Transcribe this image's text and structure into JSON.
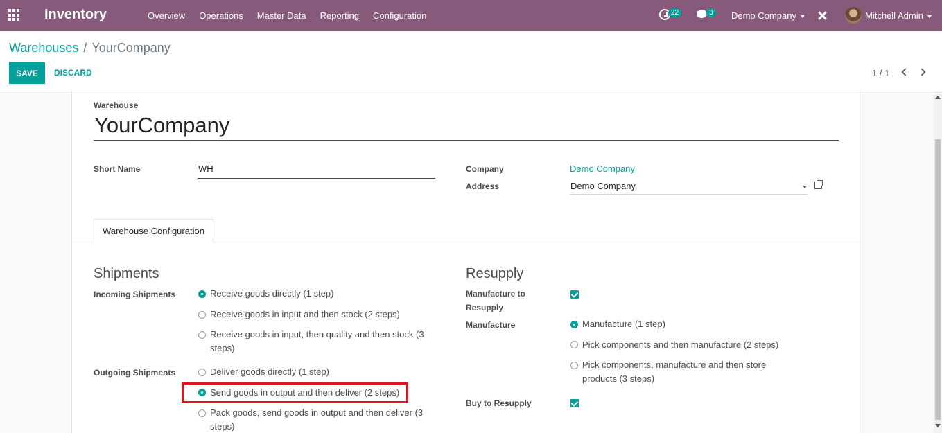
{
  "navbar": {
    "app_name": "Inventory",
    "menu": [
      "Overview",
      "Operations",
      "Master Data",
      "Reporting",
      "Configuration"
    ],
    "activity_count": "22",
    "message_count": "3",
    "company": "Demo Company",
    "user": "Mitchell Admin"
  },
  "breadcrumb": {
    "parent": "Warehouses",
    "separator": "/",
    "current": "YourCompany"
  },
  "buttons": {
    "save": "SAVE",
    "discard": "DISCARD"
  },
  "pager": "1 / 1",
  "form": {
    "warehouse_label": "Warehouse",
    "warehouse_name": "YourCompany",
    "short_name_label": "Short Name",
    "short_name": "WH",
    "company_label": "Company",
    "company_value": "Demo Company",
    "address_label": "Address",
    "address_value": "Demo Company"
  },
  "tab": "Warehouse Configuration",
  "shipments": {
    "title": "Shipments",
    "incoming_label": "Incoming Shipments",
    "incoming_options": [
      "Receive goods directly (1 step)",
      "Receive goods in input and then stock (2 steps)",
      "Receive goods in input, then quality and then stock (3 steps)"
    ],
    "incoming_selected": 0,
    "outgoing_label": "Outgoing Shipments",
    "outgoing_options": [
      "Deliver goods directly (1 step)",
      "Send goods in output and then deliver (2 steps)",
      "Pack goods, send goods in output and then deliver (3 steps)"
    ],
    "outgoing_selected": 1
  },
  "resupply": {
    "title": "Resupply",
    "manufacture_to_resupply_label": "Manufacture to Resupply",
    "manufacture_to_resupply_checked": true,
    "manufacture_label": "Manufacture",
    "manufacture_options": [
      "Manufacture (1 step)",
      "Pick components and then manufacture (2 steps)",
      "Pick components, manufacture and then store products (3 steps)"
    ],
    "manufacture_selected": 0,
    "buy_to_resupply_label": "Buy to Resupply",
    "buy_to_resupply_checked": true
  },
  "colors": {
    "navbar": "#875A7B",
    "accent": "#00A09D",
    "highlight": "#e0161e"
  }
}
